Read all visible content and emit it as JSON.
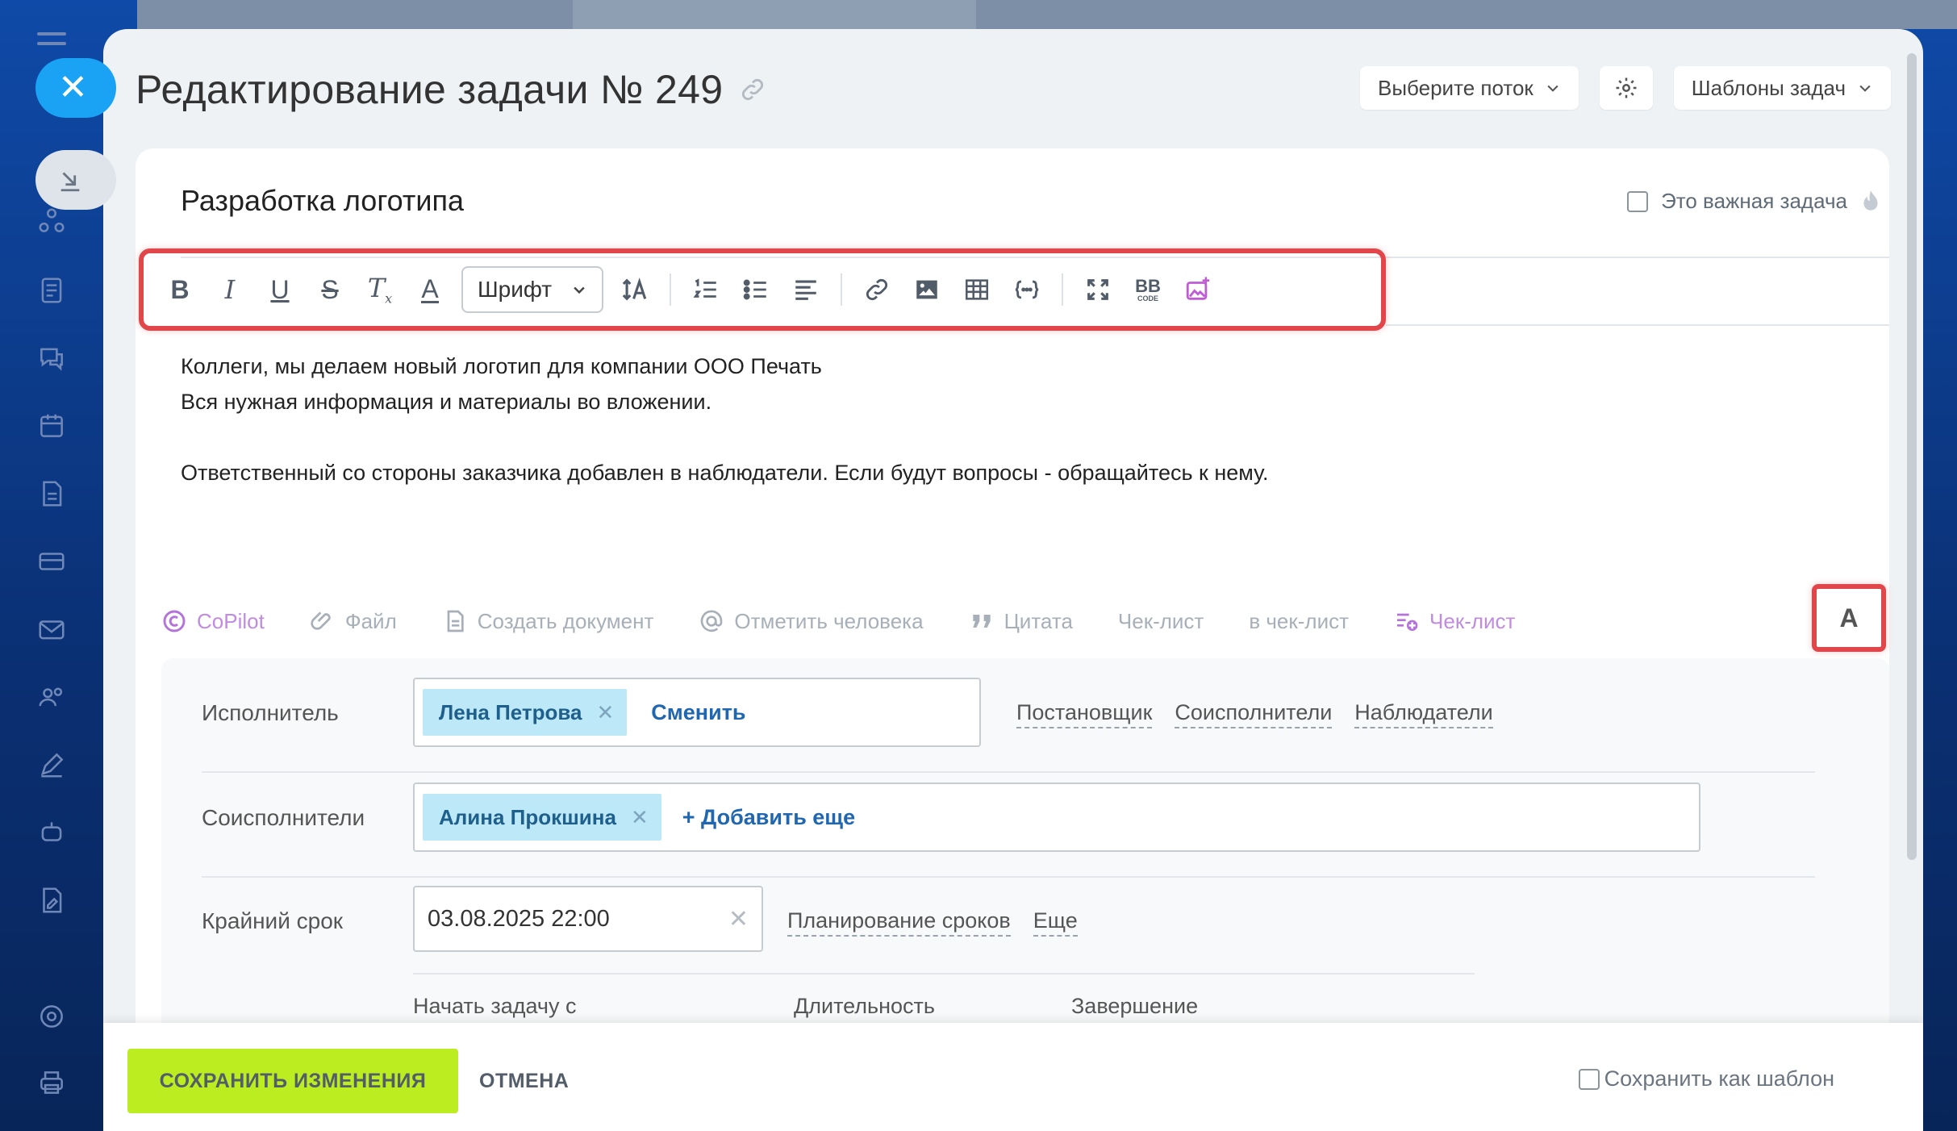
{
  "title": "Редактирование задачи № 249",
  "header": {
    "flow_select": "Выберите поток",
    "templates": "Шаблоны задач"
  },
  "task": {
    "name": "Разработка логотипа",
    "important_label": "Это важная задача"
  },
  "toolbar": {
    "font_select": "Шрифт",
    "items": [
      "bold",
      "italic",
      "underline",
      "strikethrough",
      "clear-format",
      "text-color",
      "font",
      "font-size",
      "numbered-list",
      "bullet-list",
      "align",
      "link",
      "image",
      "table",
      "code",
      "fullscreen",
      "bbcode",
      "ai-image"
    ]
  },
  "description": {
    "lines": [
      "Коллеги, мы делаем новый логотип для компании ООО Печать",
      "Вся нужная информация и материалы во вложении.",
      "",
      "Ответственный со стороны заказчика добавлен в наблюдатели. Если будут вопросы - обращайтесь к нему."
    ]
  },
  "actions": {
    "copilot": "CoPilot",
    "file": "Файл",
    "create_doc": "Создать документ",
    "mention": "Отметить человека",
    "quote": "Цитата",
    "checklist": "Чек-лист",
    "to_checklist": "в чек-лист",
    "checklist_add": "Чек-лист",
    "format_toggle": "A"
  },
  "fields": {
    "assignee": {
      "label": "Исполнитель",
      "person": "Лена Петрова",
      "change": "Сменить",
      "links": [
        "Постановщик",
        "Соисполнители",
        "Наблюдатели"
      ]
    },
    "coassignees": {
      "label": "Соисполнители",
      "person": "Алина Прокшина",
      "add_more": "+ Добавить еще"
    },
    "deadline": {
      "label": "Крайний срок",
      "value": "03.08.2025 22:00",
      "planning": "Планирование сроков",
      "more": "Еще",
      "sub_labels": [
        "Начать задачу с",
        "Длительность",
        "Завершение"
      ]
    }
  },
  "footer": {
    "save": "СОХРАНИТЬ ИЗМЕНЕНИЯ",
    "cancel": "ОТМЕНА",
    "save_template": "Сохранить как шаблон"
  },
  "colors": {
    "accent_green": "#bbed21",
    "link_blue": "#2067b0",
    "chip_bg": "#bce8f8",
    "highlight_red": "#e0464a",
    "copilot_purple": "#c08be0"
  }
}
